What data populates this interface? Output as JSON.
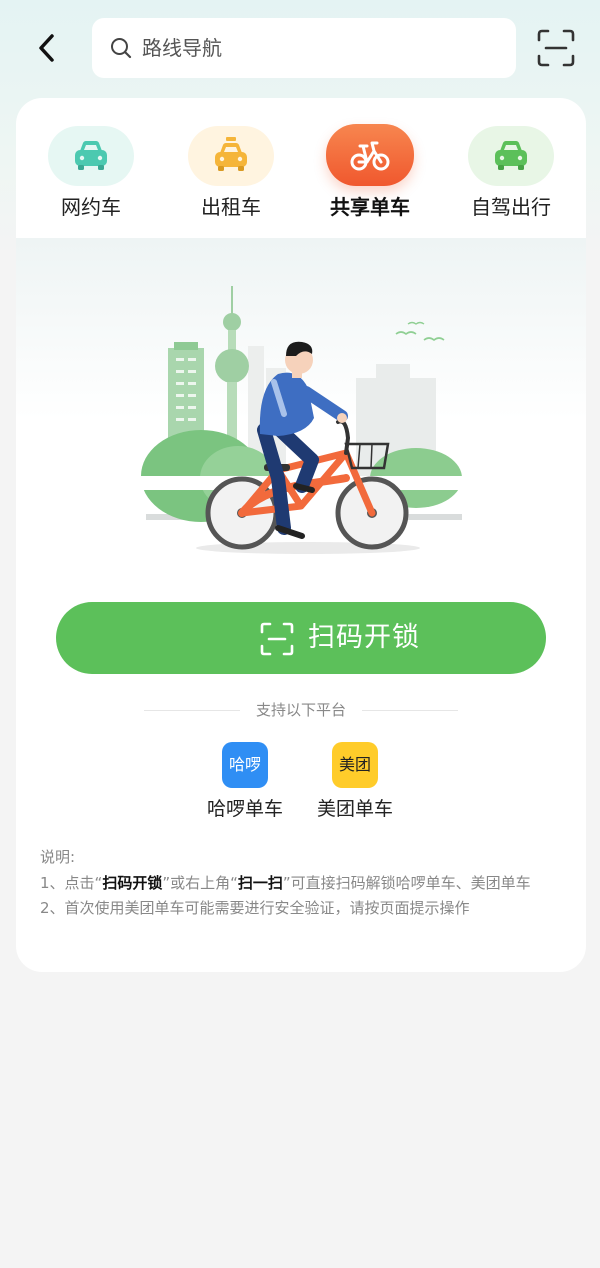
{
  "header": {
    "search_placeholder": "路线导航"
  },
  "tabs": [
    {
      "label": "网约车",
      "icon": "car-icon",
      "color": "#4cc9b0",
      "bg": "#e6f7f3",
      "active": false
    },
    {
      "label": "出租车",
      "icon": "taxi-icon",
      "color": "#f5b53a",
      "bg": "#fff4e0",
      "active": false
    },
    {
      "label": "共享单车",
      "icon": "bicycle-icon",
      "color": "#ffffff",
      "bg": "#f46b3c",
      "active": true
    },
    {
      "label": "自驾出行",
      "icon": "car-icon",
      "color": "#5cc05a",
      "bg": "#e8f6e6",
      "active": false
    }
  ],
  "main": {
    "unlock_label": "扫码开锁",
    "platforms_title": "支持以下平台",
    "platforms": [
      {
        "name": "哈啰单车",
        "logo_text": "哈啰",
        "color": "#2f8ef4"
      },
      {
        "name": "美团单车",
        "logo_text": "美团",
        "color": "#ffcc2a"
      }
    ],
    "notes": {
      "title": "说明:",
      "line1_prefix": "1、点击“",
      "line1_bold1": "扫码开锁",
      "line1_mid": "”或右上角“",
      "line1_bold2": "扫一扫",
      "line1_suffix": "”可直接扫码解锁哈啰单车、美团单车",
      "line2": "2、首次使用美团单车可能需要进行安全验证，请按页面提示操作"
    }
  },
  "colors": {
    "accent_green": "#5cc05a",
    "accent_orange": "#f46b3c"
  }
}
